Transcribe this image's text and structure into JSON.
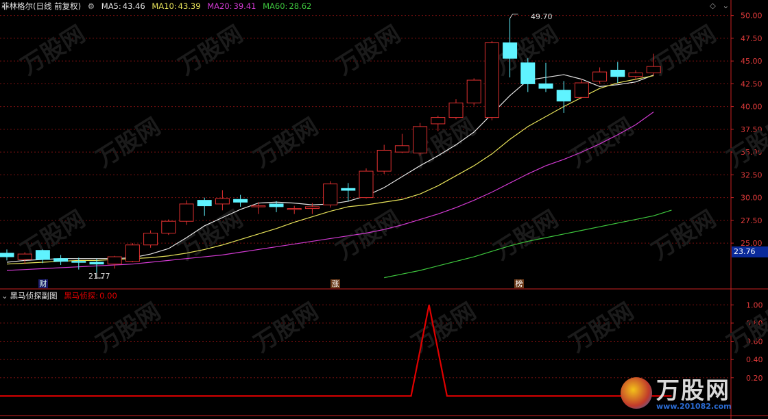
{
  "header": {
    "stock": "菲林格尔(日线 前复权)",
    "ma5_label": "MA5:",
    "ma5_value": "43.46",
    "ma5_color": "#e6e6e6",
    "ma10_label": "MA10:",
    "ma10_value": "43.39",
    "ma10_color": "#e8e35a",
    "ma20_label": "MA20:",
    "ma20_value": "39.41",
    "ma20_color": "#d23ad2",
    "ma60_label": "MA60:",
    "ma60_value": "28.62",
    "ma60_color": "#3ec83e"
  },
  "sub_header": {
    "title": "黑马侦探副图",
    "indicator_label": "黑马侦探:",
    "indicator_value": "0.00"
  },
  "markers": {
    "cai": "财",
    "zhang": "涨",
    "bang": "榜"
  },
  "price_tag": {
    "value": "23.76",
    "bg": "#0a2a9a"
  },
  "annotations": {
    "high": "49.70",
    "low": "21.77"
  },
  "colors": {
    "up": "#e03030",
    "down": "#5ff3ff",
    "grid": "#7a1010",
    "axis": "#cc2222",
    "indicator": "#e00000"
  },
  "watermark": {
    "text": "万股网",
    "url": "www.201082.com"
  },
  "chart_data": [
    {
      "type": "candlestick",
      "title": "菲林格尔(日线 前复权)",
      "y_ticks": [
        "50.00",
        "47.50",
        "45.00",
        "42.50",
        "40.00",
        "37.50",
        "35.00",
        "32.50",
        "30.00",
        "27.50",
        "25.00"
      ],
      "ylim": [
        22.0,
        50.5
      ],
      "candles": [
        {
          "o": 23.9,
          "h": 24.3,
          "c": 23.5,
          "l": 23.1
        },
        {
          "o": 23.2,
          "h": 24.0,
          "c": 23.8,
          "l": 22.7
        },
        {
          "o": 24.2,
          "h": 24.3,
          "c": 23.2,
          "l": 22.8
        },
        {
          "o": 23.3,
          "h": 23.7,
          "c": 23.0,
          "l": 22.6
        },
        {
          "o": 23.0,
          "h": 23.4,
          "c": 22.9,
          "l": 22.1
        },
        {
          "o": 22.9,
          "h": 23.3,
          "c": 22.7,
          "l": 21.77
        },
        {
          "o": 22.7,
          "h": 23.6,
          "c": 23.5,
          "l": 22.2
        },
        {
          "o": 23.0,
          "h": 25.0,
          "c": 24.8,
          "l": 22.9
        },
        {
          "o": 24.8,
          "h": 26.4,
          "c": 26.1,
          "l": 24.5
        },
        {
          "o": 26.1,
          "h": 27.6,
          "c": 27.4,
          "l": 25.9
        },
        {
          "o": 27.4,
          "h": 29.7,
          "c": 29.3,
          "l": 27.0
        },
        {
          "o": 29.7,
          "h": 30.0,
          "c": 29.1,
          "l": 28.0
        },
        {
          "o": 29.3,
          "h": 30.8,
          "c": 29.9,
          "l": 28.6
        },
        {
          "o": 29.8,
          "h": 30.3,
          "c": 29.5,
          "l": 29.0
        },
        {
          "o": 29.1,
          "h": 29.5,
          "c": 29.1,
          "l": 28.2
        },
        {
          "o": 29.3,
          "h": 29.6,
          "c": 29.0,
          "l": 28.4
        },
        {
          "o": 28.8,
          "h": 29.1,
          "c": 28.8,
          "l": 28.2
        },
        {
          "o": 28.8,
          "h": 29.4,
          "c": 29.0,
          "l": 28.2
        },
        {
          "o": 29.2,
          "h": 31.8,
          "c": 31.5,
          "l": 28.9
        },
        {
          "o": 31.0,
          "h": 31.6,
          "c": 30.8,
          "l": 29.6
        },
        {
          "o": 30.0,
          "h": 33.2,
          "c": 32.9,
          "l": 29.9
        },
        {
          "o": 32.9,
          "h": 35.8,
          "c": 35.2,
          "l": 32.6
        },
        {
          "o": 35.0,
          "h": 37.0,
          "c": 35.7,
          "l": 34.9
        },
        {
          "o": 34.9,
          "h": 38.2,
          "c": 37.8,
          "l": 34.6
        },
        {
          "o": 38.1,
          "h": 39.0,
          "c": 38.8,
          "l": 37.3
        },
        {
          "o": 38.8,
          "h": 40.8,
          "c": 40.4,
          "l": 38.6
        },
        {
          "o": 40.4,
          "h": 43.1,
          "c": 42.9,
          "l": 40.1
        },
        {
          "o": 38.8,
          "h": 47.2,
          "c": 47.0,
          "l": 38.5
        },
        {
          "o": 47.0,
          "h": 49.7,
          "c": 45.3,
          "l": 43.2
        },
        {
          "o": 44.8,
          "h": 45.3,
          "c": 42.5,
          "l": 41.6
        },
        {
          "o": 42.5,
          "h": 44.8,
          "c": 42.0,
          "l": 41.6
        },
        {
          "o": 41.8,
          "h": 42.8,
          "c": 40.6,
          "l": 39.3
        },
        {
          "o": 41.0,
          "h": 43.0,
          "c": 42.6,
          "l": 40.9
        },
        {
          "o": 42.8,
          "h": 44.3,
          "c": 43.8,
          "l": 42.5
        },
        {
          "o": 44.0,
          "h": 44.9,
          "c": 43.3,
          "l": 42.6
        },
        {
          "o": 43.3,
          "h": 44.0,
          "c": 43.7,
          "l": 43.0
        },
        {
          "o": 43.7,
          "h": 45.8,
          "c": 44.4,
          "l": 43.4
        }
      ],
      "ma_series": [
        {
          "name": "MA5",
          "color": "#e6e6e6",
          "values": [
            22.9,
            23.1,
            23.2,
            23.3,
            23.3,
            23.3,
            23.3,
            23.4,
            23.8,
            24.4,
            25.6,
            26.9,
            27.8,
            28.7,
            29.4,
            29.5,
            29.4,
            29.2,
            29.3,
            29.6,
            30.2,
            31.1,
            32.3,
            33.5,
            34.6,
            35.8,
            37.2,
            39.2,
            41.2,
            42.9,
            43.2,
            43.5,
            43.0,
            42.2,
            42.4,
            42.7,
            43.46
          ]
        },
        {
          "name": "MA10",
          "color": "#e8e35a",
          "values": [
            22.7,
            22.8,
            22.9,
            23.0,
            23.1,
            23.1,
            23.2,
            23.3,
            23.4,
            23.6,
            23.9,
            24.3,
            24.8,
            25.4,
            26.0,
            26.6,
            27.3,
            27.9,
            28.5,
            29.0,
            29.2,
            29.5,
            29.8,
            30.4,
            31.3,
            32.4,
            33.5,
            34.8,
            36.4,
            37.8,
            38.9,
            40.0,
            41.0,
            42.0,
            42.6,
            43.0,
            43.39
          ]
        },
        {
          "name": "MA20",
          "color": "#d23ad2",
          "values": [
            22.0,
            22.1,
            22.2,
            22.3,
            22.4,
            22.5,
            22.6,
            22.7,
            22.9,
            23.1,
            23.3,
            23.5,
            23.7,
            24.0,
            24.3,
            24.6,
            24.9,
            25.2,
            25.5,
            25.8,
            26.1,
            26.5,
            27.0,
            27.6,
            28.2,
            28.9,
            29.7,
            30.6,
            31.6,
            32.6,
            33.5,
            34.2,
            35.0,
            35.9,
            36.9,
            38.0,
            39.41
          ]
        },
        {
          "name": "MA60",
          "color": "#3ec83e",
          "start_index": 21,
          "values": [
            21.2,
            21.6,
            22.0,
            22.5,
            23.0,
            23.5,
            24.1,
            24.7,
            25.2,
            25.6,
            26.0,
            26.4,
            26.8,
            27.2,
            27.6,
            28.0,
            28.62
          ]
        }
      ]
    },
    {
      "type": "line",
      "title": "黑马侦探副图",
      "y_ticks": [
        "1.00",
        "0.80",
        "0.60",
        "0.40",
        "0.20"
      ],
      "ylim": [
        -0.2,
        1.1
      ],
      "series": [
        {
          "name": "黑马侦探",
          "x": [
            0,
            22.5,
            23.5,
            24.5,
            37
          ],
          "values": [
            0,
            0,
            1,
            0,
            0
          ]
        }
      ]
    }
  ]
}
